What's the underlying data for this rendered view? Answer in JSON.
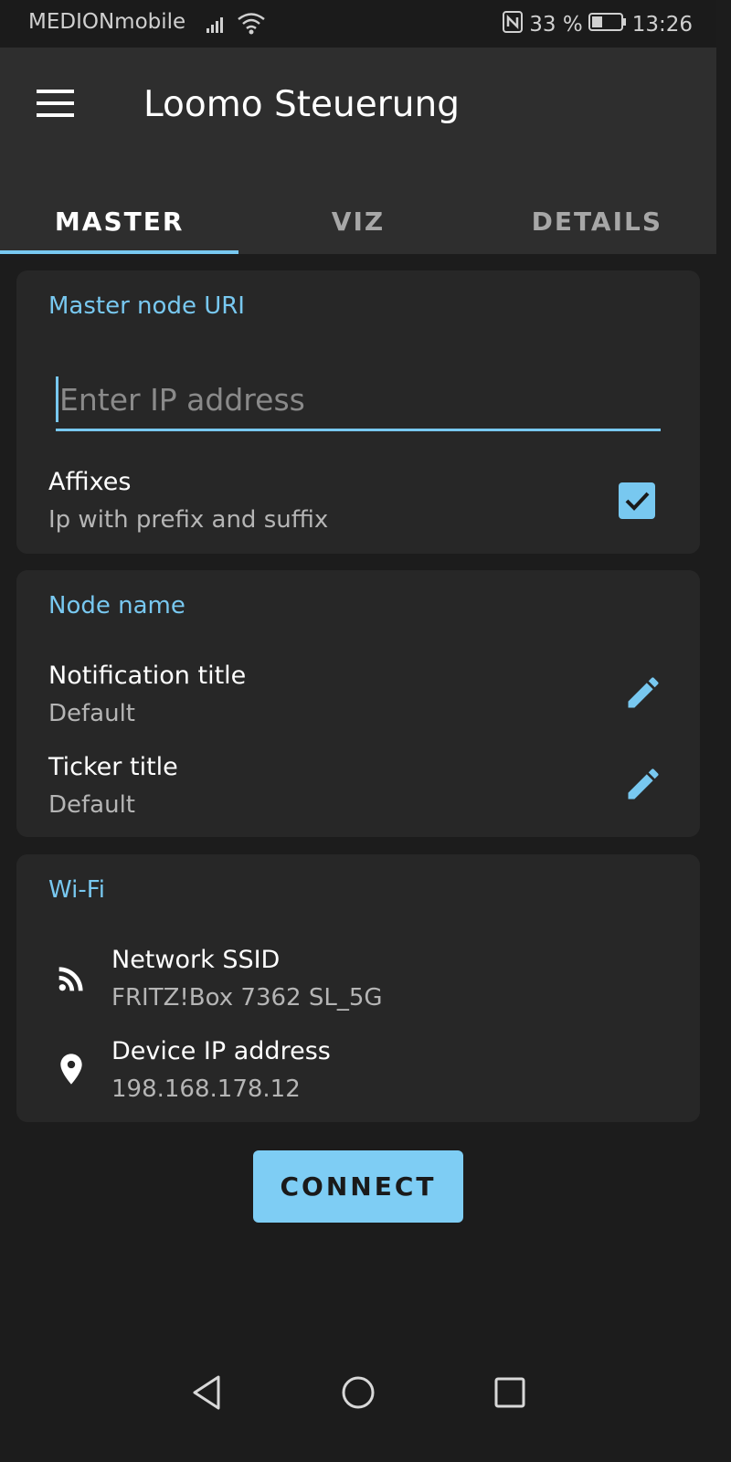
{
  "status_bar": {
    "carrier": "MEDIONmobile",
    "battery": "33 %",
    "time": "13:26",
    "icons": [
      "signal-icon",
      "wifi-icon",
      "nfc-icon",
      "battery-icon"
    ]
  },
  "app_bar": {
    "title": "Loomo Steuerung",
    "menu_icon": "hamburger-menu-icon"
  },
  "tabs": [
    {
      "label": "MASTER",
      "active": true
    },
    {
      "label": "VIZ",
      "active": false
    },
    {
      "label": "DETAILS",
      "active": false
    }
  ],
  "master_card": {
    "title": "Master node URI",
    "ip_input": {
      "value": "",
      "placeholder": "Enter IP address"
    },
    "affixes": {
      "label": "Affixes",
      "sublabel": "Ip with prefix and suffix",
      "checked": true
    }
  },
  "node_card": {
    "title": "Node name",
    "items": [
      {
        "label": "Notification title",
        "value": "Default",
        "icon": "edit-pencil-icon"
      },
      {
        "label": "Ticker title",
        "value": "Default",
        "icon": "edit-pencil-icon"
      }
    ]
  },
  "wifi_card": {
    "title": "Wi-Fi",
    "items": [
      {
        "label": "Network SSID",
        "value": "FRITZ!Box 7362 SL_5G",
        "icon": "wifi-feed-icon"
      },
      {
        "label": "Device IP address",
        "value": "198.168.178.12",
        "icon": "location-pin-icon"
      }
    ]
  },
  "connect_button": {
    "label": "CONNECT"
  },
  "nav_bar": {
    "icons": [
      "back-icon",
      "home-icon",
      "recents-icon"
    ]
  },
  "colors": {
    "accent": "#78c8f0",
    "background": "#1c1c1c",
    "card": "#272727",
    "app_bar": "#2e2e2e"
  }
}
